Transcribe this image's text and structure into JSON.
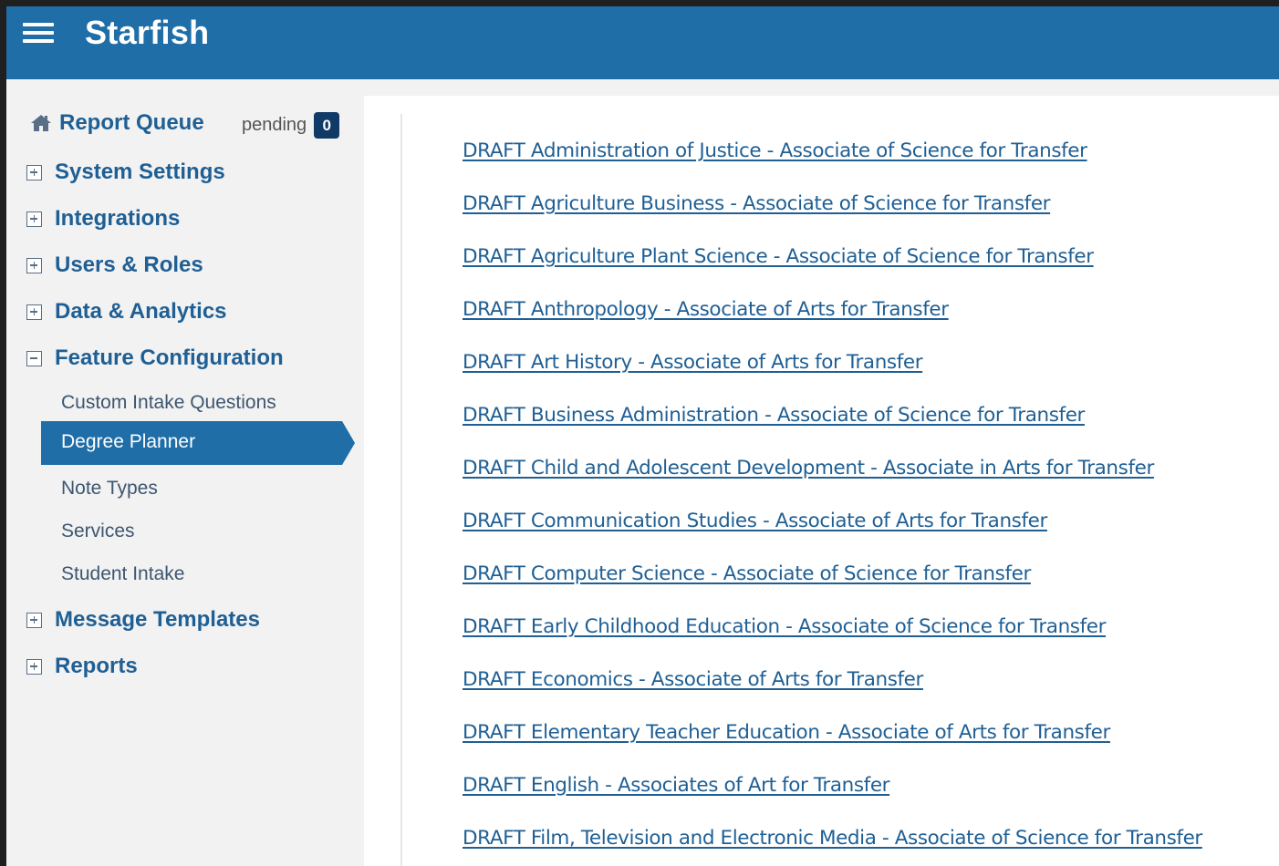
{
  "header": {
    "title": "Starfish",
    "menu_icon": "hamburger-menu-icon"
  },
  "sidebar": {
    "report_queue": {
      "label": "Report Queue",
      "icon": "home-icon",
      "status": "pending",
      "count": "0"
    },
    "sections": [
      {
        "label": "System Settings",
        "icon": "plus-box-icon",
        "expanded": false
      },
      {
        "label": "Integrations",
        "icon": "plus-box-icon",
        "expanded": false
      },
      {
        "label": "Users & Roles",
        "icon": "plus-box-icon",
        "expanded": false
      },
      {
        "label": "Data & Analytics",
        "icon": "plus-box-icon",
        "expanded": false
      },
      {
        "label": "Feature Configuration",
        "icon": "minus-box-icon",
        "expanded": true
      },
      {
        "label": "Message Templates",
        "icon": "plus-box-icon",
        "expanded": false
      },
      {
        "label": "Reports",
        "icon": "plus-box-icon",
        "expanded": false
      }
    ],
    "feature_items": [
      {
        "label": "Custom Intake Questions",
        "active": false
      },
      {
        "label": "Degree Planner",
        "active": true
      },
      {
        "label": "Note Types",
        "active": false
      },
      {
        "label": "Services",
        "active": false
      },
      {
        "label": "Student Intake",
        "active": false
      }
    ],
    "active_color": "#1f6ea8"
  },
  "main": {
    "degree_links": [
      "DRAFT Administration of Justice - Associate of Science for Transfer",
      "DRAFT Agriculture Business - Associate of Science for Transfer",
      "DRAFT Agriculture Plant Science - Associate of Science for Transfer",
      "DRAFT Anthropology - Associate of Arts for Transfer",
      "DRAFT Art History - Associate of Arts for Transfer",
      "DRAFT Business Administration - Associate of Science for Transfer",
      "DRAFT Child and Adolescent Development - Associate in Arts for Transfer",
      "DRAFT Communication Studies - Associate of Arts for Transfer",
      "DRAFT Computer Science - Associate of Science for Transfer",
      "DRAFT Early Childhood Education - Associate of Science for Transfer",
      "DRAFT Economics - Associate of Arts for Transfer",
      "DRAFT Elementary Teacher Education - Associate of Arts for Transfer",
      "DRAFT English - Associates of Art for Transfer",
      "DRAFT Film, Television and Electronic Media - Associate of Science for Transfer"
    ]
  }
}
